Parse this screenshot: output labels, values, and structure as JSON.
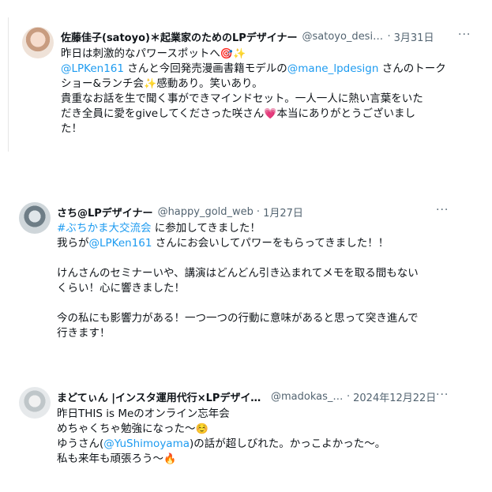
{
  "tweets": [
    {
      "name": "佐藤佳子(satoyo)＊起業家のためのLPデザイナー",
      "handle": "@satoyo_design",
      "date": "3月31日",
      "more": "···",
      "lines": {
        "l1": "昨日は刺激的なパワースポットへ",
        "l1_emoji": "🎯✨",
        "l2_link1": "@LPKen161",
        "l2_mid": " さんと今回発売漫画書籍モデルの",
        "l2_link2": "@mane_lpdesign",
        "l2_end": " さんのトーク",
        "l3": "ショー&ランチ会",
        "l3_emoji": "✨",
        "l3_end": "感動あり。笑いあり。",
        "l4": "貴重なお話を生で聞く事ができマインドセット。一人一人に熱い言葉をいた",
        "l5": "だき全員に愛をgiveしてくださった咲さん",
        "l5_emoji": "💗",
        "l5_end": "本当にありがとうございまし",
        "l6": "た！"
      }
    },
    {
      "name": "さち@LPデザイナー",
      "handle": "@happy_gold_web",
      "date": "1月27日",
      "more": "···",
      "lines": {
        "l1_link": "#ぶちかま大交流会",
        "l1_end": " に参加してきました！",
        "l2": "我らが",
        "l2_link": "@LPKen161",
        "l2_end": " さんにお会いしてパワーをもらってきました！！",
        "l3": "けんさんのセミナーいや、講演はどんどん引き込まれてメモを取る間もない",
        "l4": "くらい！心に響きました！",
        "l5": "今の私にも影響力がある！一つ一つの行動に意味があると思って突き進んで",
        "l6": "行きます！"
      }
    },
    {
      "name": "まどてぃん |インスタ運用代行×LPデザイナー",
      "handle": "@madokas_design",
      "date": "2024年12月22日",
      "more": "···",
      "lines": {
        "l1": "昨日THIS is Meのオンライン忘年会",
        "l2": "めちゃくちゃ勉強になった〜",
        "l2_emoji": "☺️",
        "l3": "ゆうさん(",
        "l3_link": "@YuShimoyama",
        "l3_end": ")の話が超しびれた。かっこよかった〜。",
        "l4": "私も来年も頑張ろう〜",
        "l4_emoji": "🔥"
      }
    }
  ]
}
